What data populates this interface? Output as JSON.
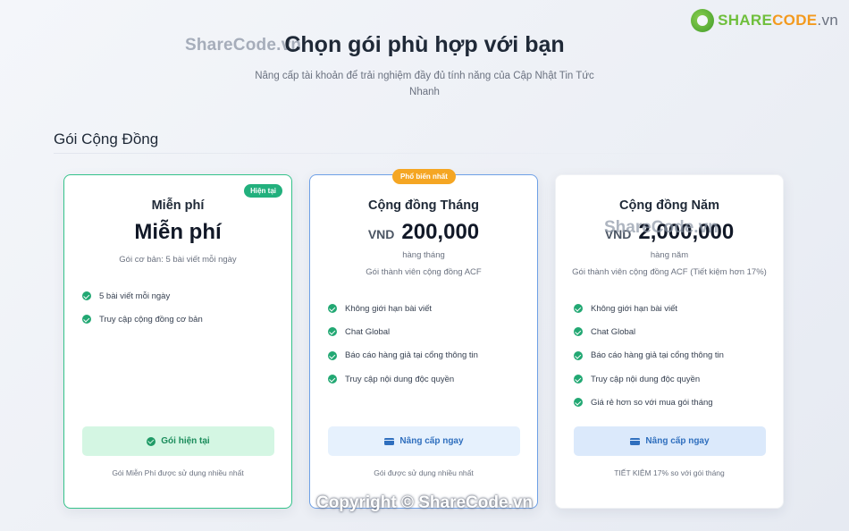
{
  "branding": {
    "logo_part1": "SHARE",
    "logo_part2": "CODE",
    "logo_part3": ".vn",
    "watermark": "ShareCode.vn",
    "copyright": "Copyright © ShareCode.vn"
  },
  "header": {
    "title": "Chọn gói phù hợp với bạn",
    "subtitle": "Nâng cấp tài khoản để trải nghiệm đầy đủ tính năng của Cập Nhật Tin Tức Nhanh"
  },
  "section": {
    "title": "Gói Cộng Đồng"
  },
  "plans": [
    {
      "badge": "Hiện tại",
      "name": "Miễn phí",
      "price": "Miễn phí",
      "description": "Gói cơ bản: 5 bài viết mỗi ngày",
      "features": [
        "5 bài viết mỗi ngày",
        "Truy cập cộng đồng cơ bản"
      ],
      "button": "Gói hiện tại",
      "note": "Gói Miễn Phí được sử dụng nhiều nhất"
    },
    {
      "badge": "Phổ biến nhất",
      "name": "Cộng đồng Tháng",
      "currency": "VND",
      "price": "200,000",
      "period": "hàng tháng",
      "description": "Gói thành viên cộng đồng ACF",
      "features": [
        "Không giới hạn bài viết",
        "Chat Global",
        "Báo cáo hàng giả tại cổng thông tin",
        "Truy cập nội dung độc quyền"
      ],
      "button": "Nâng cấp ngay",
      "note": "Gói được sử dụng nhiều nhất"
    },
    {
      "name": "Cộng đồng Năm",
      "currency": "VND",
      "price": "2,000,000",
      "period": "hàng năm",
      "description": "Gói thành viên cộng đồng ACF (Tiết kiệm hơn 17%)",
      "features": [
        "Không giới hạn bài viết",
        "Chat Global",
        "Báo cáo hàng giả tại cổng thông tin",
        "Truy cập nội dung độc quyền",
        "Giá rẻ hơn so với mua gói tháng"
      ],
      "button": "Nâng cấp ngay",
      "note": "TIẾT KIỆM 17% so với gói tháng"
    }
  ],
  "colors": {
    "accent_green": "#22b07d",
    "accent_blue": "#2f6fbe",
    "popular_orange": "#f5a623"
  }
}
